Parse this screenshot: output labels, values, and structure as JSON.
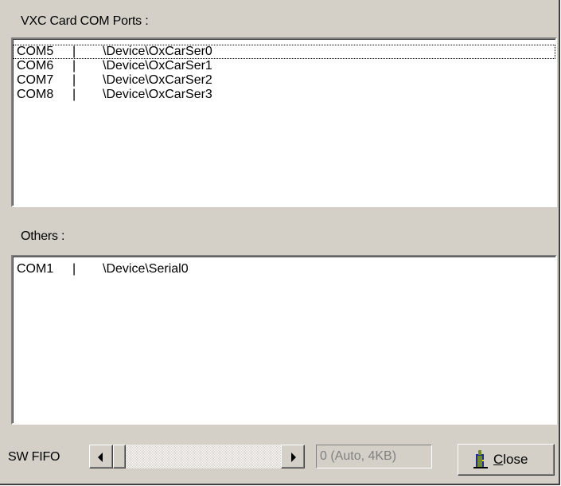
{
  "vxc_section": {
    "label": "VXC Card COM Ports :",
    "items": [
      {
        "port": "COM5",
        "sep": "|",
        "device": "\\Device\\OxCarSer0"
      },
      {
        "port": "COM6",
        "sep": "|",
        "device": "\\Device\\OxCarSer1"
      },
      {
        "port": "COM7",
        "sep": "|",
        "device": "\\Device\\OxCarSer2"
      },
      {
        "port": "COM8",
        "sep": "|",
        "device": "\\Device\\OxCarSer3"
      }
    ]
  },
  "others_section": {
    "label": "Others :",
    "items": [
      {
        "port": "COM1",
        "sep": "|",
        "device": "\\Device\\Serial0"
      }
    ]
  },
  "sw_fifo": {
    "label": "SW FIFO",
    "value_text": "0 (Auto, 4KB)",
    "slider_position": 0
  },
  "close_button": {
    "mnemonic": "C",
    "rest": "lose",
    "icon": "door-exit-icon"
  }
}
